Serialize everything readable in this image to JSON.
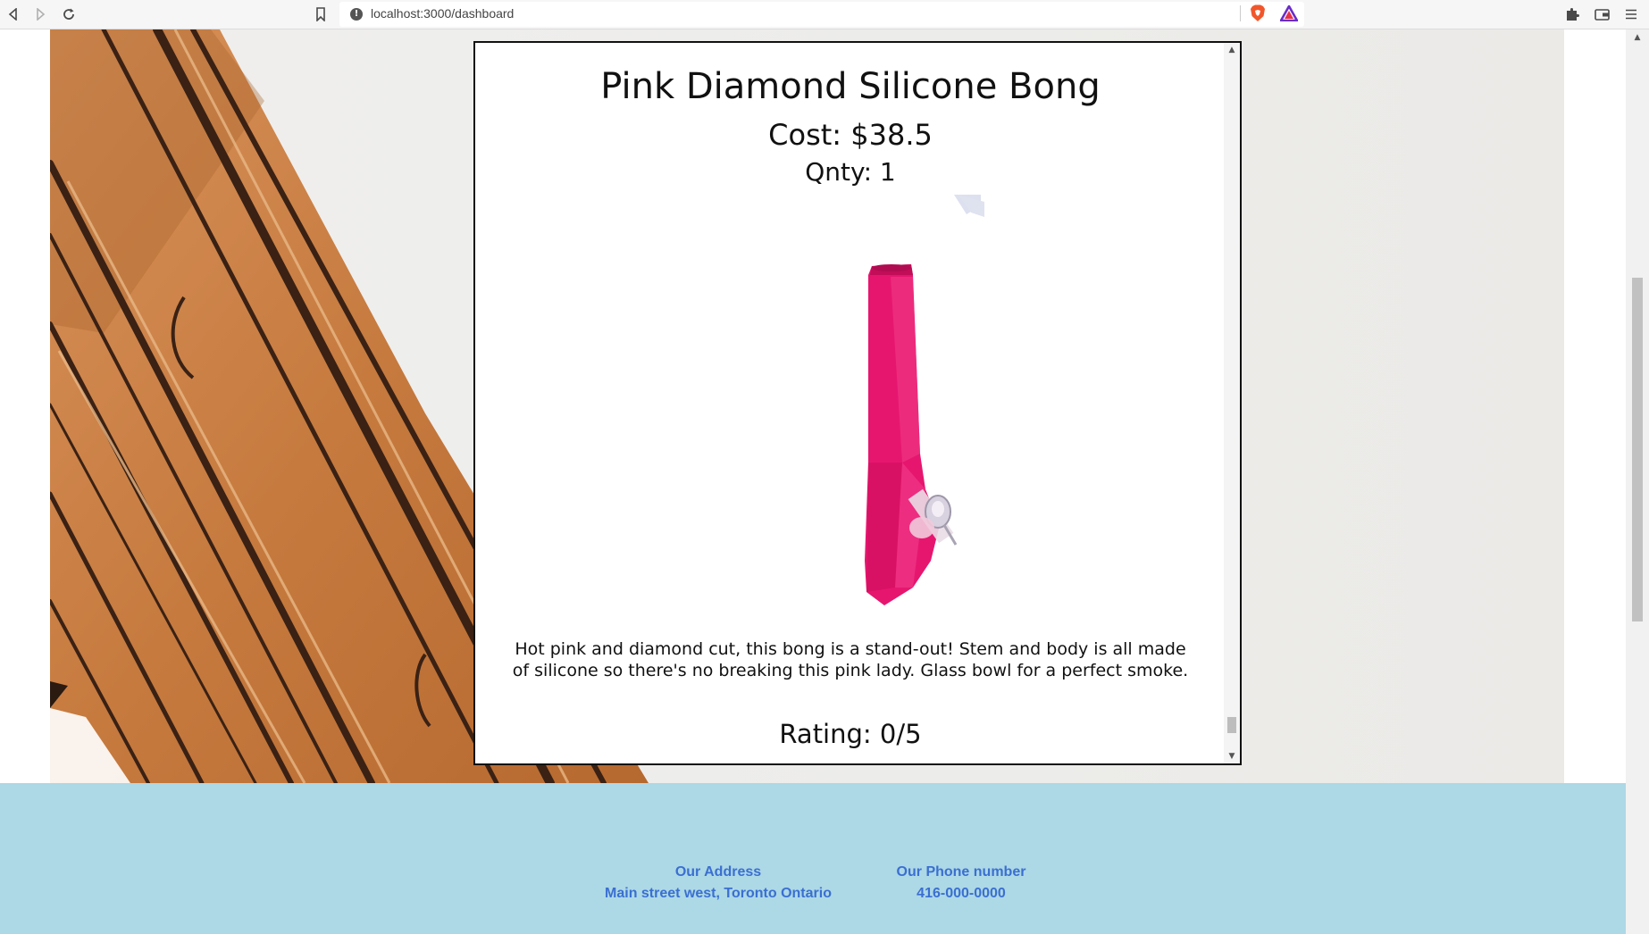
{
  "browser": {
    "url": "localhost:3000/dashboard",
    "icons": {
      "back": "back-arrow-icon",
      "forward": "forward-arrow-icon",
      "reload": "reload-icon",
      "bookmark": "bookmark-icon",
      "info": "site-info-icon",
      "brave": "brave-shield-icon",
      "rewards": "brave-rewards-icon",
      "extensions": "puzzle-extensions-icon",
      "wallet": "wallet-icon",
      "menu": "hamburger-menu-icon"
    }
  },
  "product": {
    "title": "Pink Diamond Silicone Bong",
    "cost": "Cost: $38.5",
    "quantity": "Qnty: 1",
    "description": "Hot pink and diamond cut, this bong is a stand-out! Stem and body is all made of silicone so there's no breaking this pink lady. Glass bowl for a perfect smoke.",
    "rating": "Rating: 0/5",
    "accent_color": "#e6166f"
  },
  "footer": {
    "address_heading": "Our Address",
    "address": "Main street west, Toronto Ontario",
    "phone_heading": "Our Phone number",
    "phone": "416-000-0000",
    "background_color": "#add8e6",
    "text_color": "#3a6fd1"
  }
}
